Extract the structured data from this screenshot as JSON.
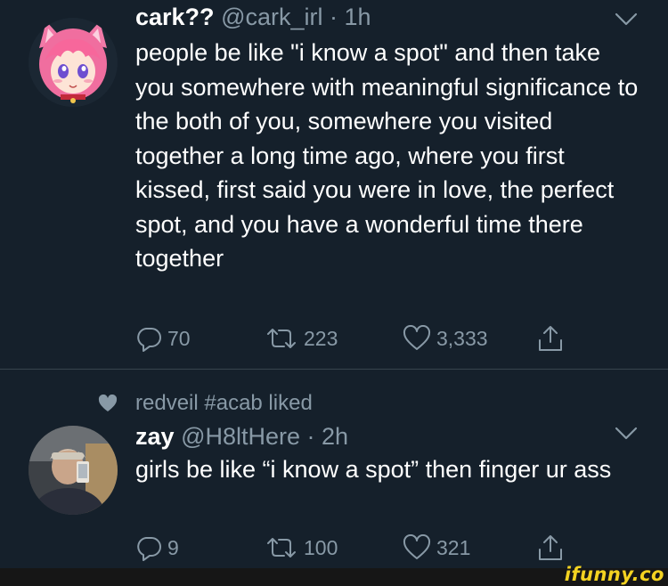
{
  "tweets": [
    {
      "name": "cark??",
      "handle": "@cark_irl · 1h",
      "text": "people be like \"i know a spot\" and then take you somewhere with meaningful significance to the both of you, somewhere you visited together a long time ago, where you first kissed, first said you were in love, the perfect spot, and you have a wonderful time there together",
      "replies": "70",
      "retweets": "223",
      "likes": "3,333"
    },
    {
      "liked_by": "redveil #acab liked",
      "name": "zay",
      "handle": "@H8ltHere · 2h",
      "text": "girls be like “i know a spot” then finger ur ass",
      "replies": "9",
      "retweets": "100",
      "likes": "321"
    }
  ],
  "icons": {
    "reply": "reply-icon",
    "retweet": "retweet-icon",
    "like": "heart-icon",
    "share": "share-icon",
    "chevron": "chevron-down-icon"
  },
  "colors": {
    "background": "#15202b",
    "text": "#ffffff",
    "secondary": "#8899a6",
    "divider": "#38444d",
    "watermark": "#f4d321"
  },
  "watermark": "ifunny.co"
}
